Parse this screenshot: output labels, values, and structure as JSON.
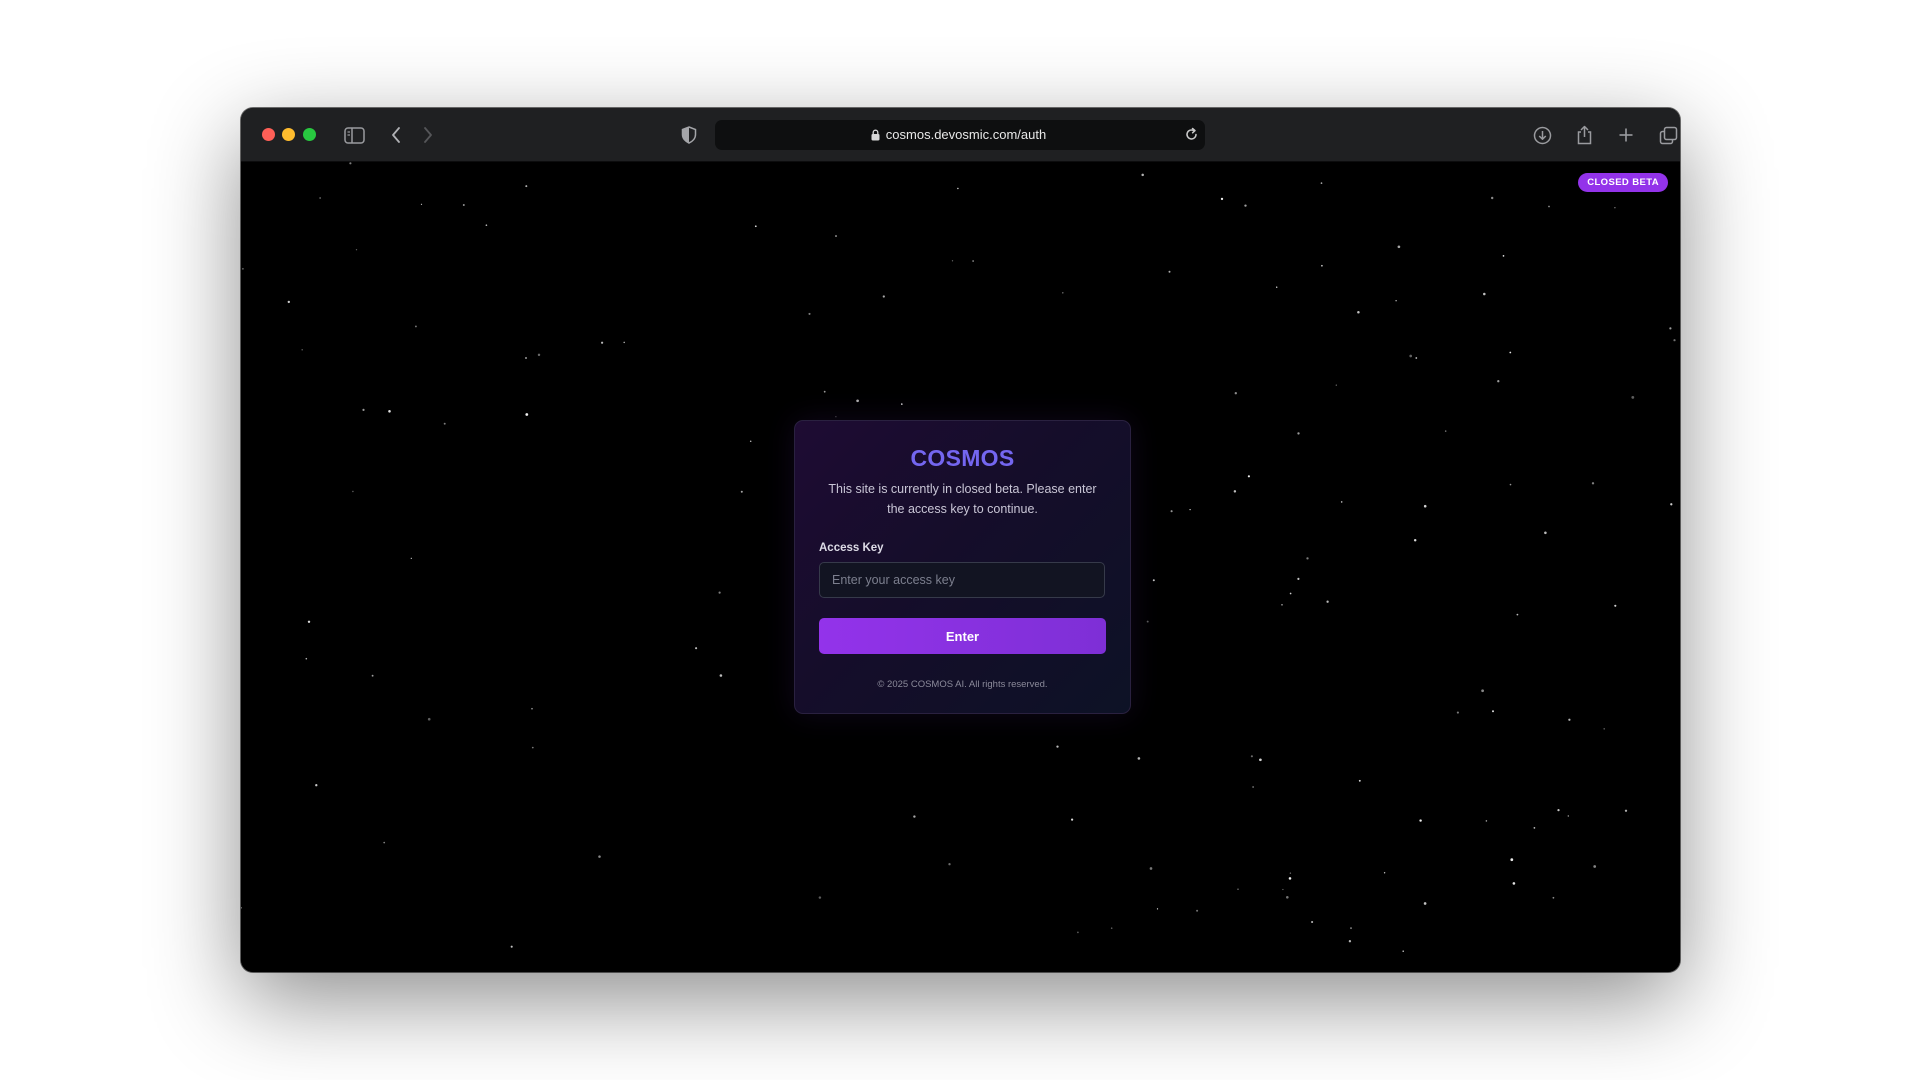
{
  "browser": {
    "url": "cosmos.devosmic.com/auth",
    "icons": [
      "sidebar-toggle-icon",
      "back-icon",
      "forward-icon",
      "shield-icon",
      "lock-icon",
      "reload-icon",
      "download-icon",
      "share-icon",
      "new-tab-icon",
      "tabs-overview-icon"
    ]
  },
  "page": {
    "badge": "CLOSED BETA",
    "card": {
      "title": "COSMOS",
      "description": "This site is currently in closed beta. Please enter the access key to continue.",
      "field_label": "Access Key",
      "input_value": "",
      "input_placeholder": "Enter your access key",
      "button_label": "Enter",
      "footer": "© 2025 COSMOS AI. All rights reserved."
    }
  },
  "colors": {
    "accent": "#9333ea",
    "title": "#7466f0",
    "background": "#000000"
  }
}
